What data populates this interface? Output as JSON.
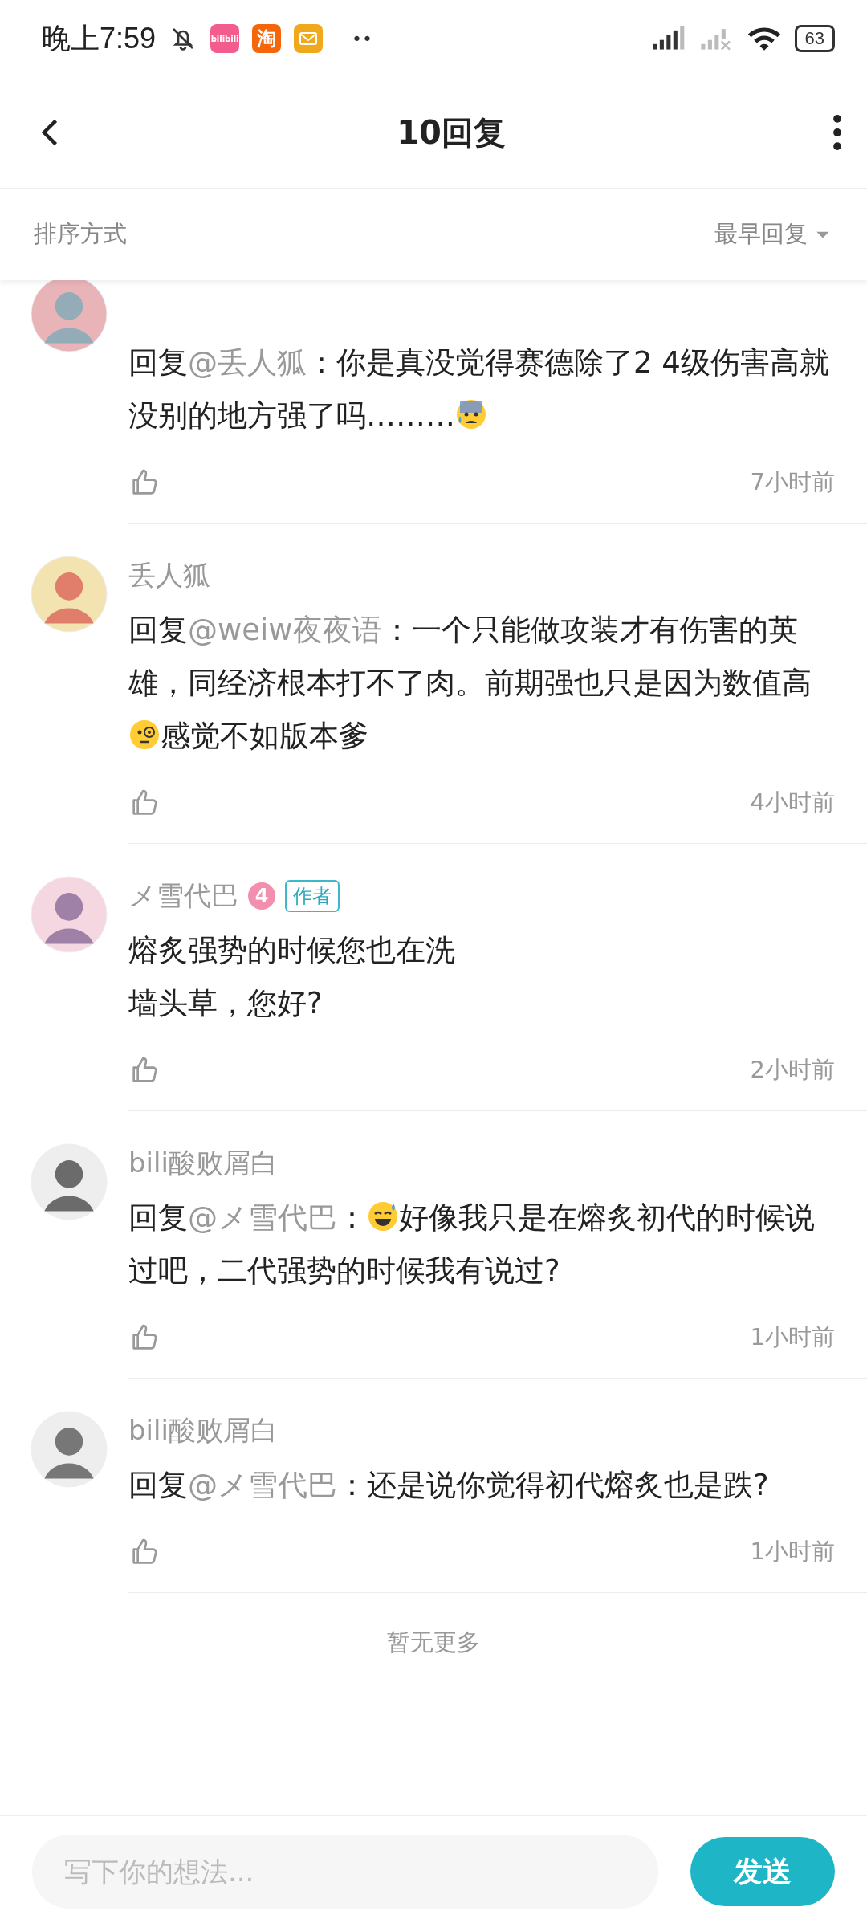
{
  "status_bar": {
    "time": "晚上7:59",
    "app_icons": [
      {
        "kind": "glyph",
        "text": "bilibili",
        "color": "#f25d8e"
      },
      {
        "kind": "glyph",
        "text": "淘",
        "color": "#f5650a"
      },
      {
        "kind": "mail",
        "color": "#f0a81c"
      }
    ],
    "more": "••",
    "battery": "63"
  },
  "header": {
    "title": "10回复"
  },
  "sort_bar": {
    "label": "排序方式",
    "value": "最早回复"
  },
  "comments": [
    {
      "author": false,
      "body": [
        {
          "kind": "text",
          "text": "回复"
        },
        {
          "kind": "mention",
          "text": "@丢人狐"
        },
        {
          "kind": "text",
          "text": "：你是真没觉得赛德除了2 4级伤害高就没别的地方强了吗………"
        },
        {
          "kind": "anxious"
        }
      ],
      "time": "7小时前"
    },
    {
      "name": "丢人狐",
      "author": false,
      "body": [
        {
          "kind": "text",
          "text": "回复"
        },
        {
          "kind": "mention",
          "text": "@weiw夜夜语"
        },
        {
          "kind": "text",
          "text": "：一个只能做攻装才有伤害的英雄，同经济根本打不了肉。前期强也只是因为数值高"
        },
        {
          "kind": "monocle"
        },
        {
          "kind": "text",
          "text": "感觉不如版本爹"
        }
      ],
      "time": "4小时前"
    },
    {
      "name": "メ雪代巴",
      "level": "4",
      "author": true,
      "author_tag": "作者",
      "body": [
        {
          "kind": "line",
          "text": "熔炙强势的时候您也在洗"
        },
        {
          "kind": "line",
          "text": "墙头草，您好?"
        }
      ],
      "time": "2小时前"
    },
    {
      "name": "bili酸败屑白",
      "author": false,
      "body": [
        {
          "kind": "text",
          "text": "回复"
        },
        {
          "kind": "mention",
          "text": "@メ雪代巴"
        },
        {
          "kind": "text",
          "text": "："
        },
        {
          "kind": "sweatsmile"
        },
        {
          "kind": "text",
          "text": "好像我只是在熔炙初代的时候说过吧，二代强势的时候我有说过?"
        }
      ],
      "time": "1小时前"
    },
    {
      "name": "bili酸败屑白",
      "author": false,
      "body": [
        {
          "kind": "text",
          "text": "回复"
        },
        {
          "kind": "mention",
          "text": "@メ雪代巴"
        },
        {
          "kind": "text",
          "text": "：还是说你觉得初代熔炙也是跌?"
        }
      ],
      "time": "1小时前"
    }
  ],
  "end_note": "暂无更多",
  "composer": {
    "placeholder": "写下你的想法...",
    "send": "发送"
  }
}
